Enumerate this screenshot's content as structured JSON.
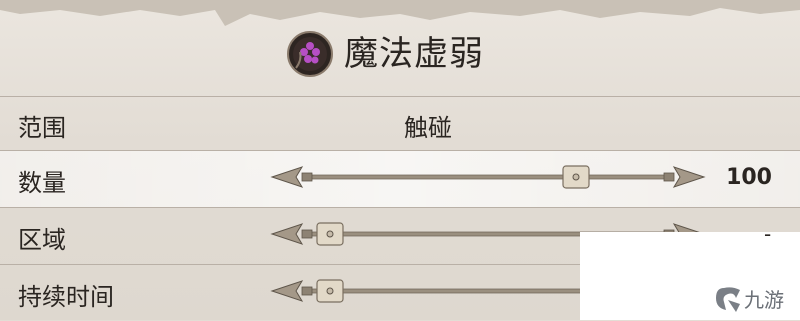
{
  "spell": {
    "title": "魔法虚弱",
    "icon": "magic-weakness-rune-icon"
  },
  "rows": [
    {
      "label": "范围",
      "value": "触碰"
    },
    {
      "label": "数量",
      "value": "100",
      "slider_fraction": 0.82
    },
    {
      "label": "区域",
      "value": "-",
      "slider_fraction": 0.0
    },
    {
      "label": "持续时间",
      "slider_fraction": 0.0
    }
  ],
  "watermark": {
    "text": "九游"
  },
  "colors": {
    "accent_purple": "#b64fc4",
    "metal": "#9a8f7f",
    "paper": "#e3ddd5"
  }
}
